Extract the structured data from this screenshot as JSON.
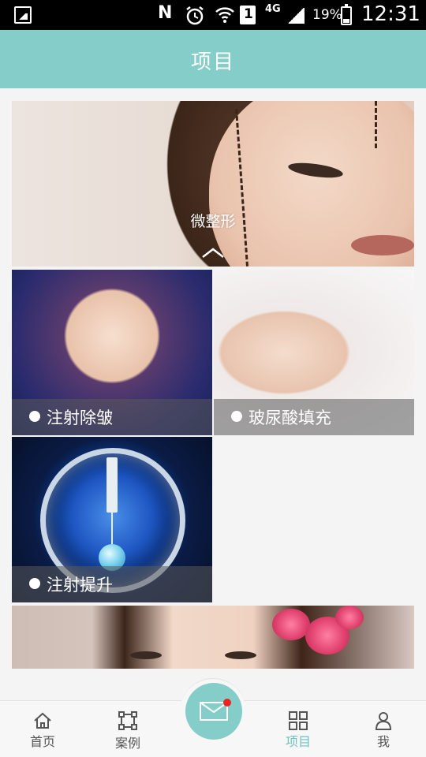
{
  "status_bar": {
    "battery": "19%",
    "time": "12:31",
    "network": "4G",
    "sim": "1"
  },
  "header": {
    "title": "项目"
  },
  "banner": {
    "caption": "微整形"
  },
  "tiles": [
    {
      "label": "注射除皱"
    },
    {
      "label": "玻尿酸填充"
    },
    {
      "label": "注射提升"
    }
  ],
  "bottom_nav": {
    "items": [
      {
        "label": "首页",
        "icon": "home-icon"
      },
      {
        "label": "案例",
        "icon": "crop-frame-icon"
      },
      {
        "label": "项目",
        "icon": "grid-icon",
        "active": true
      },
      {
        "label": "我",
        "icon": "user-icon"
      }
    ],
    "center_icon": "mail-icon",
    "badge_color": "#e22222"
  },
  "colors": {
    "accent": "#85cdc9",
    "active_tab": "#6cc3c0"
  }
}
